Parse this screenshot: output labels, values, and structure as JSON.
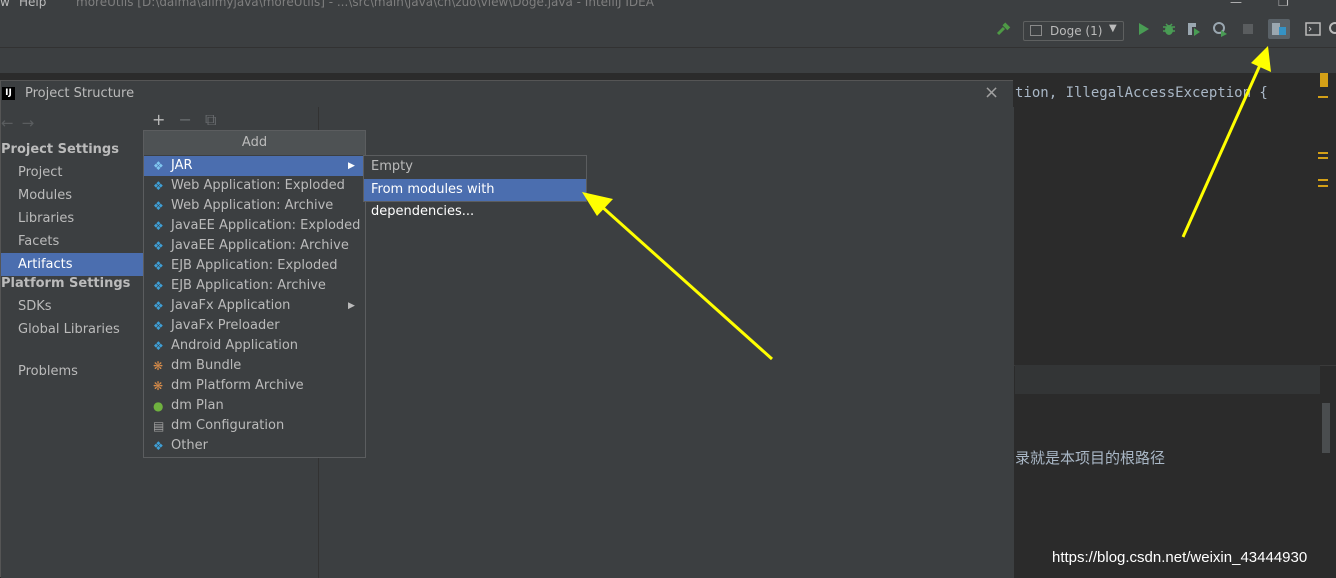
{
  "titlebar": {
    "menu_fragment": "w",
    "help": "Help",
    "window_title": "moreUtils [D:\\daima\\allmyjava\\moreUtils] - ...\\src\\main\\java\\cn\\zuo\\view\\Doge.java - IntelliJ IDEA",
    "minimize": "—",
    "restore": "❐"
  },
  "toolbar": {
    "run_config_label": "Doge (1)",
    "colors": {
      "run": "#499c54",
      "debug": "#499c54",
      "build": "#4e9a45",
      "accent_yellow": "#ffff00"
    }
  },
  "editor": {
    "code_tail": "tion, IllegalAccessException {",
    "comment_fragment": "录就是本项目的根路径"
  },
  "dialog": {
    "title": "Project Structure",
    "close": "×",
    "project_settings_header": "Project Settings",
    "project_settings": [
      "Project",
      "Modules",
      "Libraries",
      "Facets",
      "Artifacts"
    ],
    "platform_settings_header": "Platform Settings",
    "platform_settings": [
      "SDKs",
      "Global Libraries"
    ],
    "problems": "Problems",
    "selected": "Artifacts",
    "tools": {
      "add": "+",
      "remove": "−",
      "copy": "⧉"
    }
  },
  "add_menu": {
    "title": "Add",
    "items": [
      "JAR",
      "Web Application: Exploded",
      "Web Application: Archive",
      "JavaEE Application: Exploded",
      "JavaEE Application: Archive",
      "EJB Application: Exploded",
      "EJB Application: Archive",
      "JavaFx Application",
      "JavaFx Preloader",
      "Android Application",
      "dm Bundle",
      "dm Platform Archive",
      "dm Plan",
      "dm Configuration",
      "Other"
    ],
    "selected": "JAR"
  },
  "jar_submenu": {
    "items": [
      "Empty",
      "From modules with dependencies..."
    ],
    "selected": "From modules with dependencies..."
  },
  "watermark": "https://blog.csdn.net/weixin_43444930"
}
